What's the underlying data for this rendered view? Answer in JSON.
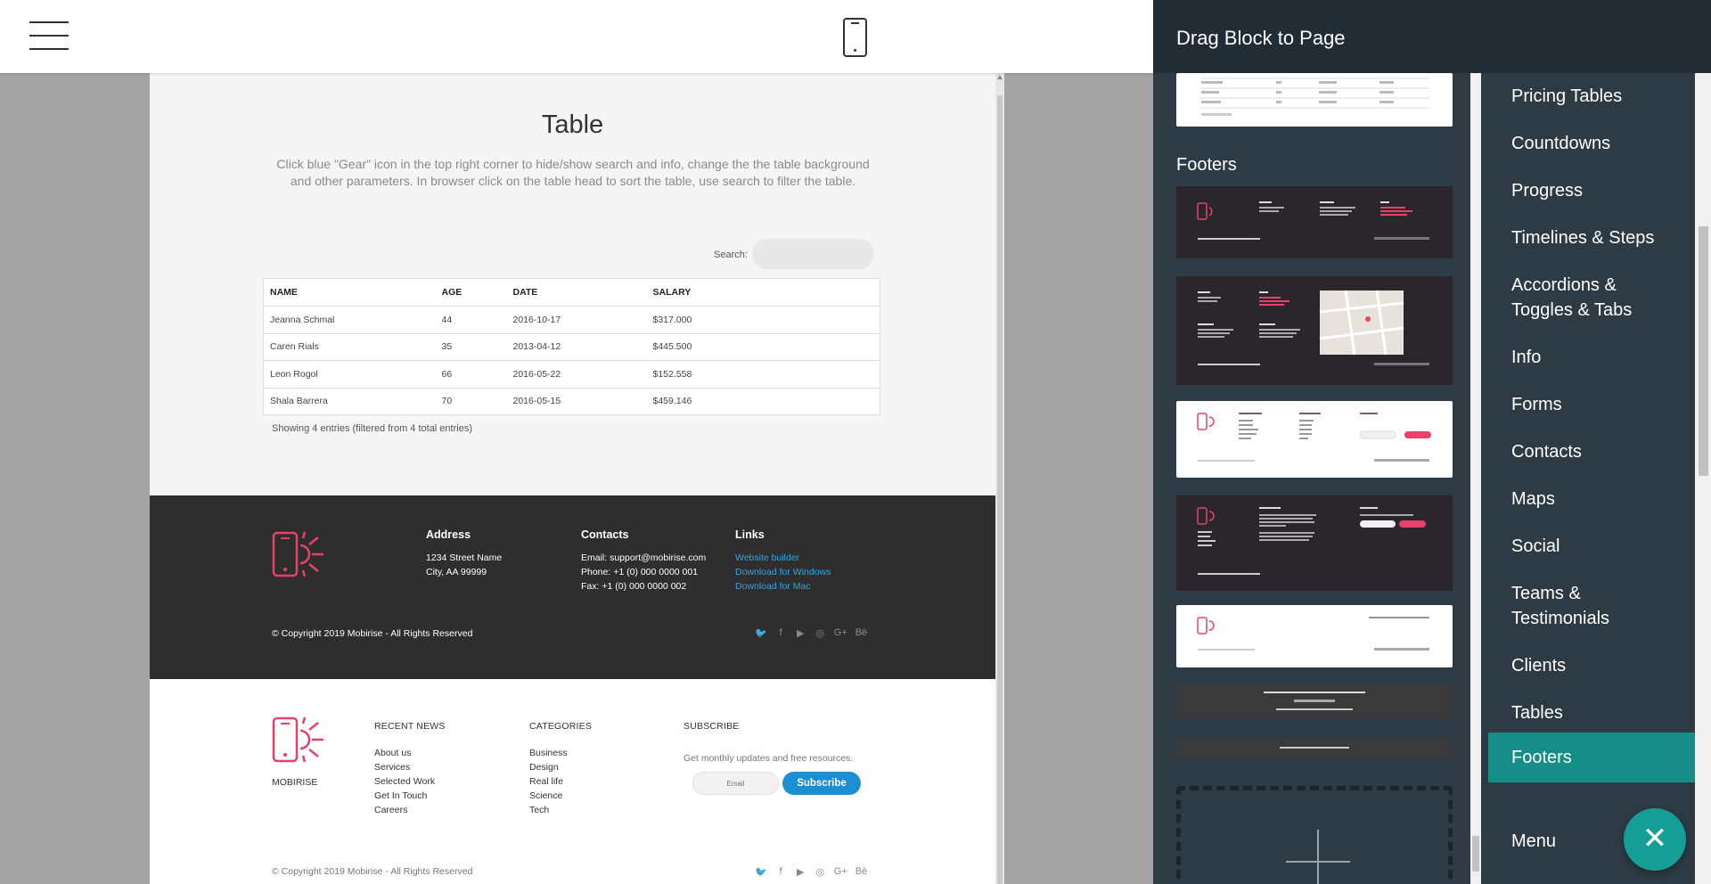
{
  "toolbar": {
    "menu_icon": "hamburger-icon",
    "preview_icon": "mobile-phone-icon"
  },
  "table_block": {
    "title": "Table",
    "description": "Click blue \"Gear\" icon in the top right corner to hide/show search and info, change the the table background and other parameters. In browser click on the table head to sort the table, use search to filter the table.",
    "search_label": "Search:",
    "search_value": "",
    "headers": [
      "NAME",
      "AGE",
      "DATE",
      "SALARY"
    ],
    "rows": [
      [
        "Jeanna Schmal",
        "44",
        "2016-10-17",
        "$317.000"
      ],
      [
        "Caren Rials",
        "35",
        "2013-04-12",
        "$445.500"
      ],
      [
        "Leon Rogol",
        "66",
        "2016-05-22",
        "$152.558"
      ],
      [
        "Shala Barrera",
        "70",
        "2016-05-15",
        "$459.146"
      ]
    ],
    "info": "Showing 4 entries (filtered from 4 total entries)"
  },
  "footer_dark": {
    "address_title": "Address",
    "address_line1": "1234 Street Name",
    "address_line2": "City, AA 99999",
    "contacts_title": "Contacts",
    "email": "Email: support@mobirise.com",
    "phone": "Phone: +1 (0) 000 0000 001",
    "fax": "Fax: +1 (0) 000 0000 002",
    "links_title": "Links",
    "link1": "Website builder",
    "link2": "Download for Windows",
    "link3": "Download for Mac",
    "copyright": "© Copyright 2019 Mobirise - All Rights Reserved",
    "socials": [
      "twitter",
      "facebook",
      "youtube",
      "instagram",
      "google-plus",
      "behance"
    ]
  },
  "footer_light": {
    "brand": "MOBIRISE",
    "recent_news_title": "RECENT NEWS",
    "recent_news": [
      "About us",
      "Services",
      "Selected Work",
      "Get In Touch",
      "Careers"
    ],
    "categories_title": "CATEGORIES",
    "categories": [
      "Business",
      "Design",
      "Real life",
      "Science",
      "Tech"
    ],
    "subscribe_title": "SUBSCRIBE",
    "subscribe_text": "Get monthly updates and free resources.",
    "email_placeholder": "Email",
    "subscribe_button": "Subscribe",
    "copyright": "© Copyright 2019 Mobirise - All Rights Reserved"
  },
  "panel": {
    "title": "Drag Block to Page",
    "section_label": "Footers",
    "categories": [
      "Pricing Tables",
      "Countdowns",
      "Progress",
      "Timelines & Steps",
      "Accordions & Toggles & Tabs",
      "Info",
      "Forms",
      "Contacts",
      "Maps",
      "Social",
      "Teams & Testimonials",
      "Clients",
      "Tables",
      "Footers",
      "Menu"
    ],
    "active_category": "Footers",
    "fab_icon": "close-icon"
  },
  "colors": {
    "accent_teal": "#168d87",
    "brand_pink": "#e8426a",
    "link_blue": "#2fa7e0",
    "button_blue": "#1b8fd1",
    "panel_bg": "#2e3b44"
  }
}
